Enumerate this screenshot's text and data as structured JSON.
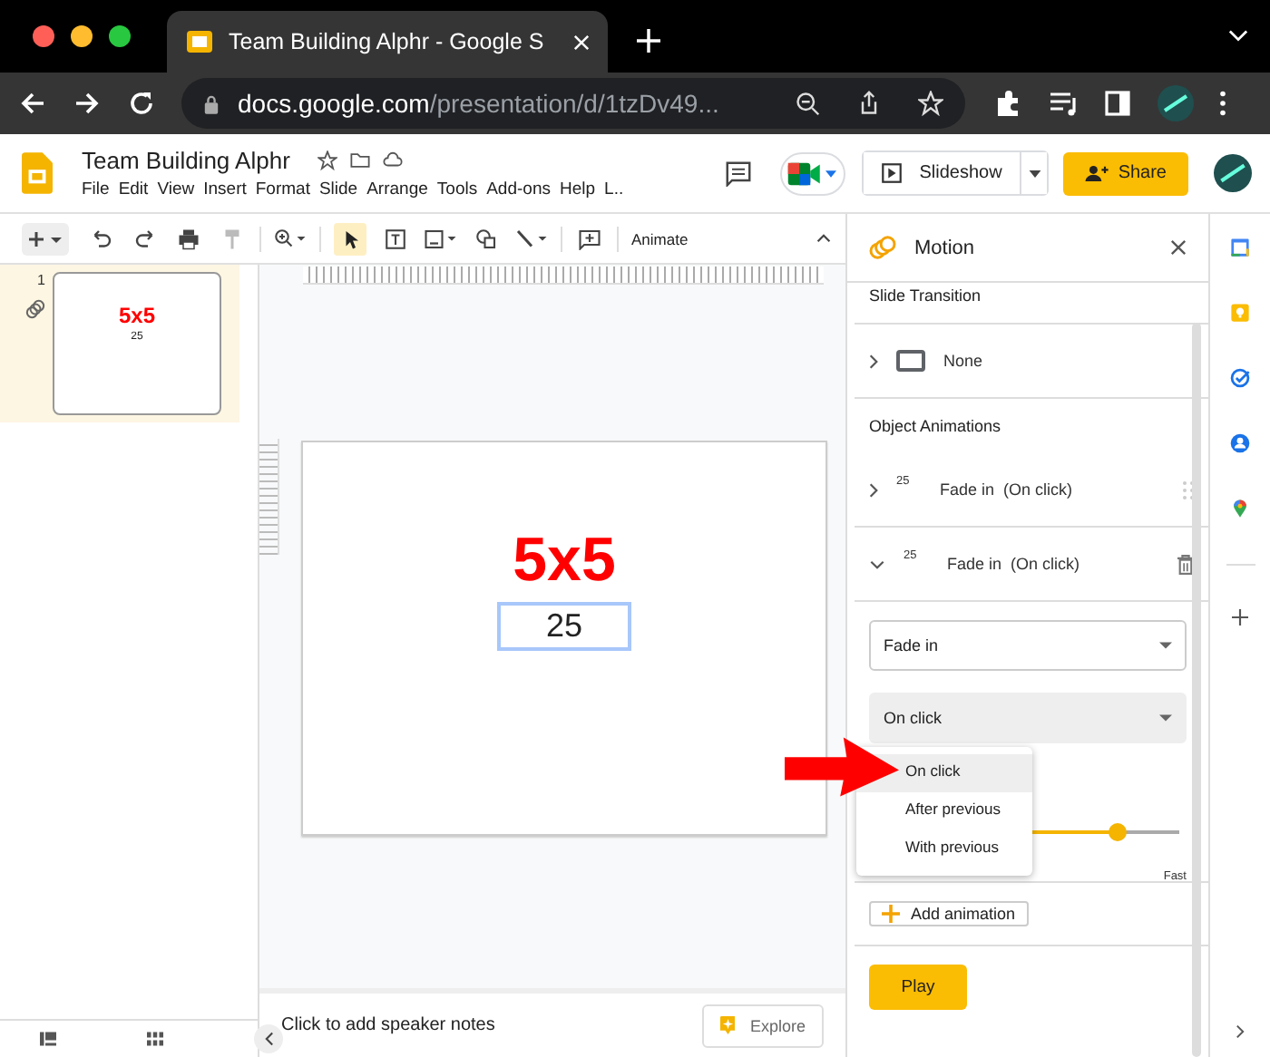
{
  "browser": {
    "tab_title": "Team Building Alphr - Google S",
    "url_host": "docs.google.com",
    "url_path": "/presentation/d/1tzDv49..."
  },
  "header": {
    "doc_title": "Team Building Alphr",
    "menu": [
      "File",
      "Edit",
      "View",
      "Insert",
      "Format",
      "Slide",
      "Arrange",
      "Tools",
      "Add-ons",
      "Help",
      "L.."
    ],
    "slideshow": "Slideshow",
    "share": "Share"
  },
  "toolbar": {
    "animate": "Animate"
  },
  "filmstrip": {
    "slides": [
      {
        "number": "1",
        "title": "5x5",
        "body": "25",
        "selected": true
      }
    ]
  },
  "slide": {
    "title": "5x5",
    "body": "25"
  },
  "motion": {
    "title": "Motion",
    "transition_heading": "Slide Transition",
    "transition": "None",
    "animations_heading": "Object Animations",
    "animations": [
      {
        "tag": "25",
        "label": "Fade in  (On click)",
        "expanded": false
      },
      {
        "tag": "25",
        "label": "Fade in  (On click)",
        "expanded": true
      }
    ],
    "effect": "Fade in",
    "trigger": "On click",
    "trigger_options": [
      {
        "label": "On click",
        "selected": true
      },
      {
        "label": "After previous",
        "selected": false
      },
      {
        "label": "With previous",
        "selected": false
      }
    ],
    "speed": {
      "level": 0.8,
      "fast_label": "Fast"
    },
    "add_animation": "Add animation",
    "play": "Play"
  },
  "notes": {
    "placeholder": "Click to add speaker notes",
    "explore": "Explore"
  }
}
